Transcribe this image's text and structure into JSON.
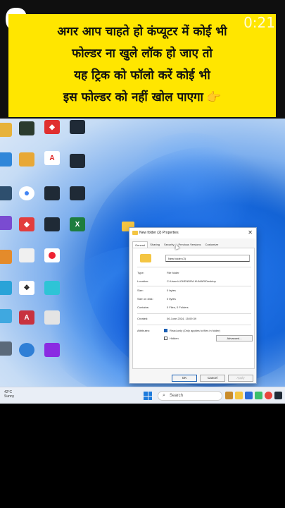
{
  "video": {
    "timer": "0:21",
    "caption_lines": [
      "अगर आप चाहते हो कंप्यूटर में कोई भी",
      "फोल्डर ना खुले लॉक हो जाए तो",
      "यह ट्रिक को फॉलो करें कोई भी",
      "इस फोल्डर को नहीं खोल पाएगा"
    ],
    "caption_emoji": "👉"
  },
  "dialog": {
    "title": "New folder (2) Properties",
    "tabs": [
      "General",
      "Sharing",
      "Security",
      "Previous Versions",
      "Customize"
    ],
    "active_tab": "General",
    "folder_name": "New folder (2)",
    "type_label": "Type:",
    "type_value": "File folder",
    "location_label": "Location:",
    "location_value": "C:\\Users\\LOKENDRA KUMAR\\Desktop",
    "size_label": "Size:",
    "size_value": "0 bytes",
    "size_on_disk_label": "Size on disk:",
    "size_on_disk_value": "0 bytes",
    "contains_label": "Contains:",
    "contains_value": "0 Files, 0 Folders",
    "created_label": "Created:",
    "created_value": "06 June 2024, 15:09:39",
    "attributes_label": "Attributes:",
    "readonly_label": "Read-only (Only applies to files in folder)",
    "readonly_checked": true,
    "hidden_label": "Hidden",
    "hidden_checked": false,
    "advanced_label": "Advanced...",
    "ok_label": "OK",
    "cancel_label": "Cancel",
    "apply_label": "Apply"
  },
  "taskbar": {
    "temperature": "42°C",
    "weather": "Sunny",
    "search_placeholder": "Search"
  }
}
